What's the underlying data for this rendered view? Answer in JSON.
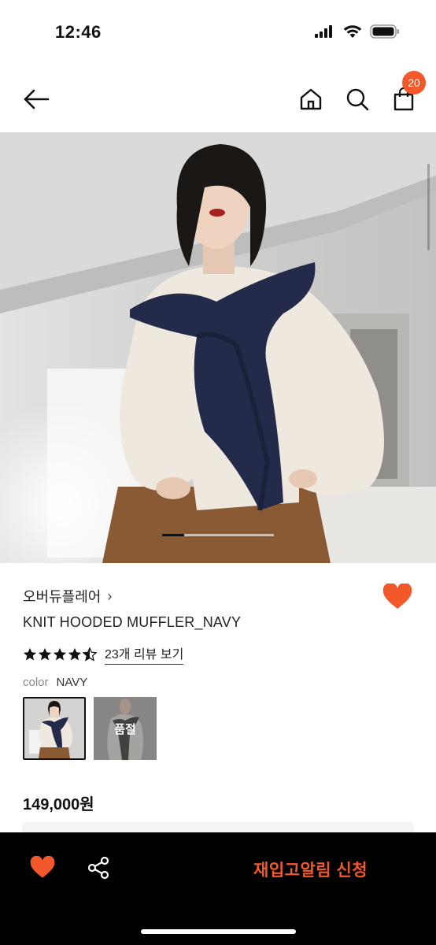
{
  "status_bar": {
    "time": "12:46"
  },
  "nav": {
    "back_icon": "back-arrow-icon",
    "home_icon": "home-icon",
    "search_icon": "search-icon",
    "bag_icon": "shopping-bag-icon",
    "bag_badge": "20"
  },
  "gallery": {
    "total_pages": 5,
    "active_page": 1
  },
  "product": {
    "brand": "오버듀플레어",
    "brand_chevron": "›",
    "name": "KNIT HOODED MUFFLER_NAVY",
    "rating": 4.5,
    "review_link": "23개 리뷰 보기",
    "color_label": "color",
    "color_value": "NAVY",
    "swatches": [
      {
        "color": "NAVY",
        "selected": true,
        "sold_out": false
      },
      {
        "color": "",
        "selected": false,
        "sold_out": true,
        "sold_out_label": "품절"
      }
    ],
    "price": "149,000원"
  },
  "bottom_bar": {
    "wishlist_icon": "heart-icon",
    "share_icon": "share-icon",
    "restock_button": "재입고알림 신청"
  },
  "colors": {
    "accent": "#f2582a",
    "bottom_bar_bg": "#000000",
    "text": "#222222"
  }
}
